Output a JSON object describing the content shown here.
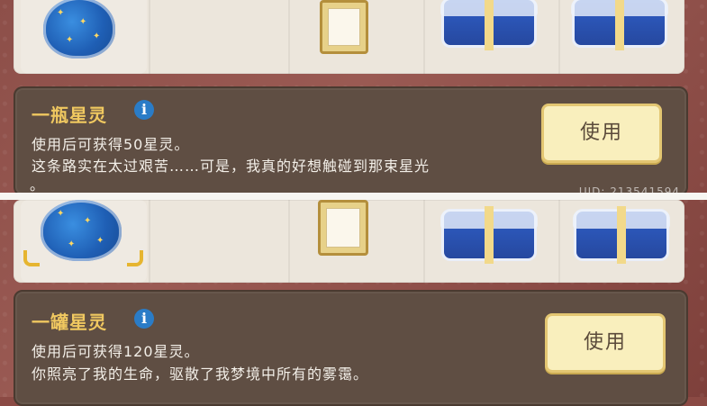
{
  "colors": {
    "background": "#8b4a44",
    "card": "#5f4e43",
    "title": "#f0c860",
    "button": "#f9efbd",
    "info_icon": "#2a7cc7"
  },
  "top_item": {
    "title": "一瓶星灵",
    "desc_line1": "使用后可获得50星灵。",
    "desc_line2": "这条路实在太过艰苦……可是，我真的好想触碰到那束星光",
    "desc_line3": "。",
    "button_label": "使用",
    "uid": "UID: 213541594"
  },
  "bottom_item": {
    "title": "一罐星灵",
    "desc_line1": "使用后可获得120星灵。",
    "desc_line2": "你照亮了我的生命，驱散了我梦境中所有的雾霭。",
    "button_label": "使用"
  },
  "info_icon_glyph": "i",
  "shelf_items": [
    "star-bottle-icon",
    "picture-frame-icon",
    "gift-box-icon",
    "gift-box-icon"
  ]
}
